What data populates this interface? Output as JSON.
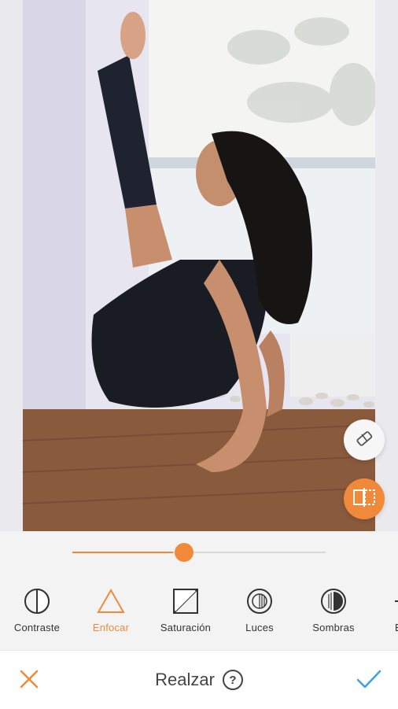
{
  "editor": {
    "title": "Realzar",
    "help_symbol": "?"
  },
  "adjust_slider": {
    "value_fraction": 0.44
  },
  "tools": [
    {
      "label": "Contraste",
      "icon": "contrast-icon",
      "active": false
    },
    {
      "label": "Enfocar",
      "icon": "sharpen-triangle-icon",
      "active": true
    },
    {
      "label": "Saturación",
      "icon": "saturation-icon",
      "active": false
    },
    {
      "label": "Luces",
      "icon": "highlights-icon",
      "active": false
    },
    {
      "label": "Sombras",
      "icon": "shadows-icon",
      "active": false
    },
    {
      "label": "E",
      "icon": "partial-tool-icon",
      "active": false
    }
  ],
  "colors": {
    "accent": "#f08a3a",
    "text": "#333333",
    "toolbar_bg": "#ffffff"
  }
}
